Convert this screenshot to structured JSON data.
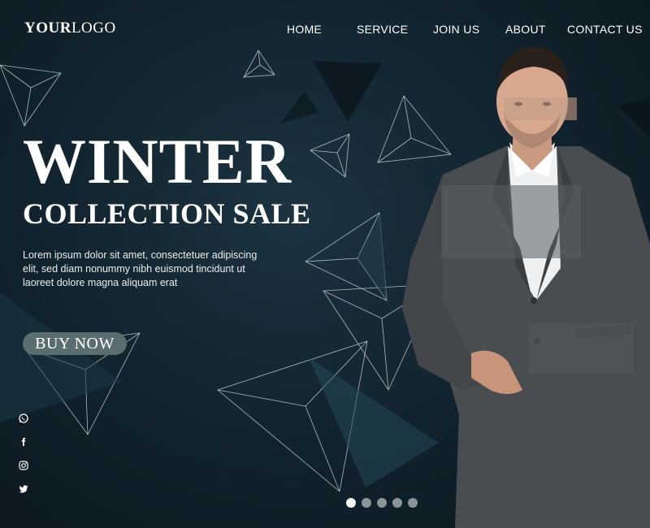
{
  "logo": {
    "bold": "YOUR",
    "light": "LOGO"
  },
  "nav": {
    "items": [
      {
        "label": "HOME"
      },
      {
        "label": "SERVICE"
      },
      {
        "label": "JOIN US"
      },
      {
        "label": "ABOUT"
      },
      {
        "label": "CONTACT US"
      }
    ]
  },
  "hero": {
    "title": "WINTER",
    "subtitle": "COLLECTION SALE",
    "description": "Lorem ipsum dolor sit amet, consectetuer adipiscing elit, sed diam nonummy nibh euismod tincidunt ut laoreet dolore magna aliquam erat",
    "button_label": "BUY NOW"
  },
  "social": {
    "icons": [
      "whatsapp-icon",
      "facebook-icon",
      "instagram-icon",
      "twitter-icon"
    ]
  },
  "carousel": {
    "count": 5,
    "active_index": 1
  },
  "colors": {
    "background": "#122530",
    "accent": "#5a6e72",
    "text": "#ffffff",
    "suit": "#4a4d50"
  }
}
